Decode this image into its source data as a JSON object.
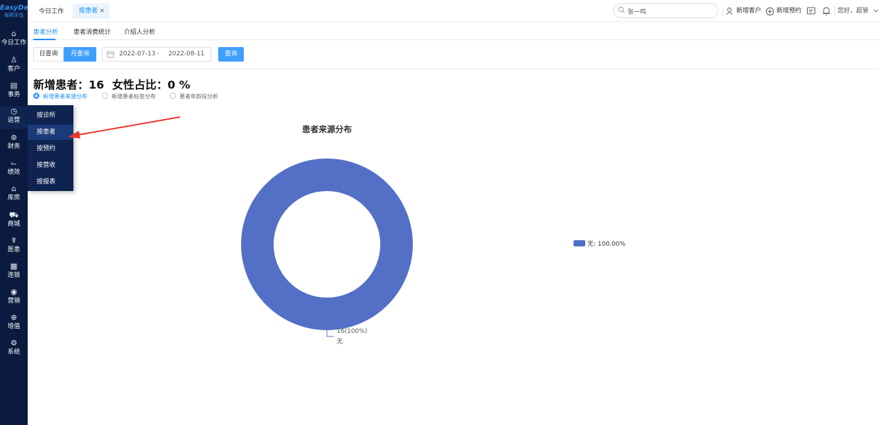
{
  "app": {
    "logo_main": "EasyDent",
    "logo_sub": "每颗牙齿"
  },
  "sidebar": {
    "items": [
      {
        "icon": "home-icon",
        "glyph": "⌂",
        "label": "今日工作"
      },
      {
        "icon": "user-icon",
        "glyph": "♙",
        "label": "客户"
      },
      {
        "icon": "task-icon",
        "glyph": "▤",
        "label": "事务"
      },
      {
        "icon": "operation-icon",
        "glyph": "◷",
        "label": "运营"
      },
      {
        "icon": "finance-icon",
        "glyph": "⊛",
        "label": "财务"
      },
      {
        "icon": "chart-line-icon",
        "glyph": "⌙",
        "label": "绩效"
      },
      {
        "icon": "warehouse-icon",
        "glyph": "⌂",
        "label": "库房"
      },
      {
        "icon": "cart-icon",
        "glyph": "⛟",
        "label": "商城"
      },
      {
        "icon": "medical-icon",
        "glyph": "☤",
        "label": "医患"
      },
      {
        "icon": "chain-icon",
        "glyph": "▦",
        "label": "连锁"
      },
      {
        "icon": "marketing-icon",
        "glyph": "◉",
        "label": "营销"
      },
      {
        "icon": "value-added-icon",
        "glyph": "⊕",
        "label": "增值"
      },
      {
        "icon": "settings-icon",
        "glyph": "⚙",
        "label": "系统"
      }
    ],
    "active_index": 3
  },
  "flyout": {
    "items": [
      "按诊所",
      "按患者",
      "按预约",
      "按营收",
      "按报表"
    ],
    "active_index": 1
  },
  "topbar": {
    "tabs": [
      {
        "label": "今日工作"
      },
      {
        "label": "按患者",
        "close": "×"
      }
    ],
    "search_value": "张一鸣",
    "actions": {
      "new_customer": "新增客户",
      "new_appointment": "新增预约"
    },
    "user_greeting": "您好，超管"
  },
  "subtabs": [
    "患者分析",
    "患者消费统计",
    "介绍人分析"
  ],
  "toolbar": {
    "day_query": "日查询",
    "month_query": "月查询",
    "date_start": "2022-07-13",
    "date_separator": "-",
    "date_end": "2022-08-11",
    "query_button": "查询"
  },
  "stats": {
    "new_patients": "新增患者：16",
    "female_ratio": "女性占比：0 %"
  },
  "radios": [
    {
      "label": "新增患者来源分布",
      "checked": true
    },
    {
      "label": "新增患者标签分布",
      "checked": false
    },
    {
      "label": "患者年龄段分析",
      "checked": false
    }
  ],
  "chart_data": {
    "type": "pie",
    "title": "患者来源分布",
    "categories": [
      "无"
    ],
    "values": [
      16
    ],
    "percentages": [
      "100%"
    ],
    "data_label": "16(100%)",
    "label_name": "无",
    "legend": [
      {
        "name": "无",
        "value": "100.00%"
      }
    ],
    "legend_text": "无: 100.00%",
    "colors": [
      "#5470c6"
    ]
  },
  "colors": {
    "sidebar_bg": "#0b1b3f",
    "accent": "#409eff",
    "series": "#5470c6"
  }
}
